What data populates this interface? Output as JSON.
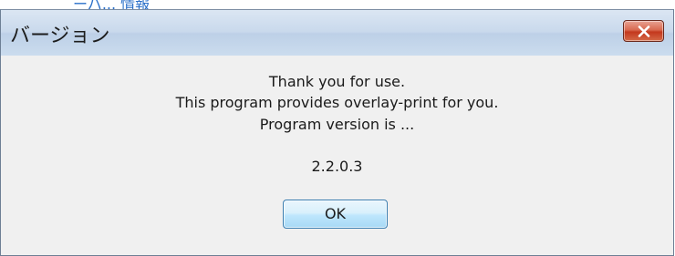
{
  "background_text": "ーバ... 情報",
  "dialog": {
    "title": "バージョン",
    "close_icon": "close-icon",
    "message_lines": [
      "Thank you for use.",
      "This program provides overlay-print for you.",
      "Program version is ..."
    ],
    "version": "2.2.0.3",
    "ok_label": "OK"
  },
  "colors": {
    "titlebar": "#c9d9ec",
    "close_button": "#c3381d",
    "ok_button_border": "#3c7fb1",
    "dialog_body": "#f0f0f0",
    "background_link": "#2a6fc9"
  }
}
